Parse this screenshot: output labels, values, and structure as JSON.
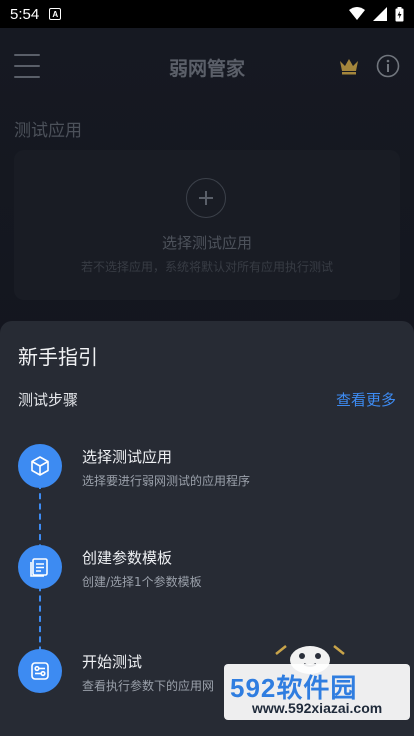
{
  "status_bar": {
    "time": "5:54",
    "notification_glyph": "A"
  },
  "header": {
    "title": "弱网管家",
    "crown_color": "#c9a44a"
  },
  "main": {
    "section_label": "测试应用",
    "select_card": {
      "title": "选择测试应用",
      "subtitle": "若不选择应用，系统将默认对所有应用执行测试"
    }
  },
  "guide_sheet": {
    "title": "新手指引",
    "steps_label": "测试步骤",
    "more_link": "查看更多",
    "accent_color": "#3d8bf2",
    "steps": [
      {
        "icon": "cube-icon",
        "title": "选择测试应用",
        "desc": "选择要进行弱网测试的应用程序"
      },
      {
        "icon": "template-icon",
        "title": "创建参数模板",
        "desc": "创建/选择1个参数模板"
      },
      {
        "icon": "settings-sliders-icon",
        "title": "开始测试",
        "desc": "查看执行参数下的应用网"
      }
    ]
  },
  "watermark": {
    "brand": "592软件园",
    "url": "www.592xiazai.com"
  }
}
